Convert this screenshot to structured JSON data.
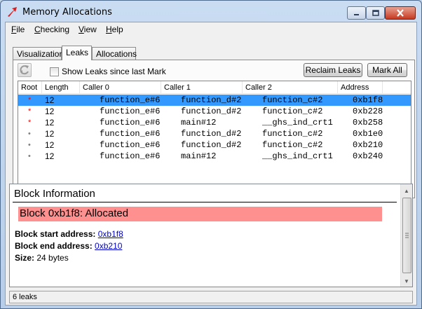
{
  "window": {
    "title": "Memory Allocations"
  },
  "menu": [
    "File",
    "Checking",
    "View",
    "Help"
  ],
  "tabs": [
    "Visualization",
    "Leaks",
    "Allocations"
  ],
  "toolbar": {
    "show_leaks_label": "Show Leaks since last Mark",
    "reclaim_label": "Reclaim Leaks",
    "mark_all_label": "Mark All"
  },
  "table": {
    "columns": [
      "Root",
      "Length",
      "Caller 0",
      "Caller 1",
      "Caller 2",
      "Address"
    ],
    "rows": [
      {
        "root": "*",
        "length": "12",
        "caller0": "function_e#6",
        "caller1": "function_d#2",
        "caller2": "function_c#2",
        "address": "0xb1f8",
        "selected": true
      },
      {
        "root": "*",
        "length": "12",
        "caller0": "function_e#6",
        "caller1": "function_d#2",
        "caller2": "function_c#2",
        "address": "0xb228",
        "selected": false
      },
      {
        "root": "*",
        "length": "12",
        "caller0": "function_e#6",
        "caller1": "main#12",
        "caller2": "__ghs_ind_crt1",
        "address": "0xb258",
        "selected": false
      },
      {
        "root": "•",
        "length": "12",
        "caller0": "function_e#6",
        "caller1": "function_d#2",
        "caller2": "function_c#2",
        "address": "0xb1e0",
        "selected": false
      },
      {
        "root": "•",
        "length": "12",
        "caller0": "function_e#6",
        "caller1": "function_d#2",
        "caller2": "function_c#2",
        "address": "0xb210",
        "selected": false
      },
      {
        "root": "•",
        "length": "12",
        "caller0": "function_e#6",
        "caller1": "main#12",
        "caller2": "__ghs_ind_crt1",
        "address": "0xb240",
        "selected": false
      }
    ]
  },
  "block_info": {
    "heading": "Block Information",
    "banner": "Block 0xb1f8: Allocated",
    "start_label": "Block start address:",
    "start_value": "0xb1f8",
    "end_label": "Block end address:",
    "end_value": "0xb210",
    "size_label": "Size:",
    "size_value": "24 bytes"
  },
  "status": {
    "text": "6 leaks"
  },
  "colors": {
    "selection": "#3399ff",
    "banner": "#ff9090",
    "root_marker": "#ff0000",
    "link": "#0000cc"
  }
}
